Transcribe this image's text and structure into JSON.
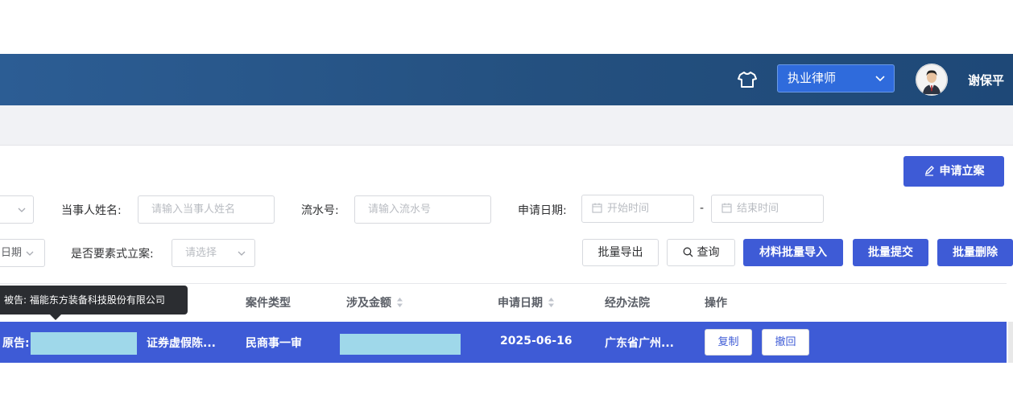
{
  "header": {
    "icon": "shirt-icon",
    "role_select": "执业律师",
    "username": "谢保平"
  },
  "actions": {
    "apply_case": "申请立案"
  },
  "filters": {
    "party_name_label": "当事人姓名:",
    "party_name_placeholder": "请输入当事人姓名",
    "serial_label": "流水号:",
    "serial_placeholder": "请输入流水号",
    "apply_date_label": "申请日期:",
    "start_date_placeholder": "开始时间",
    "date_separator": "-",
    "end_date_placeholder": "结束时间",
    "partial_date_select": "日期",
    "formal_label": "是否要素式立案:",
    "formal_placeholder": "请选择"
  },
  "toolbar": {
    "export": "批量导出",
    "query": "查询",
    "import": "材料批量导入",
    "submit": "批量提交",
    "delete": "批量删除"
  },
  "table": {
    "columns": {
      "case_type": "案件类型",
      "amount": "涉及金额",
      "apply_date": "申请日期",
      "court": "经办法院",
      "ops": "操作"
    },
    "rows": [
      {
        "plaintiff_label": "原告:",
        "cause": "证券虚假陈...",
        "case_type": "民商事一审",
        "apply_date": "2025-06-16",
        "court": "广东省广州...",
        "copy": "复制",
        "withdraw": "撤回"
      }
    ]
  },
  "tooltip": {
    "text": "被告: 福能东方装备科技股份有限公司"
  }
}
